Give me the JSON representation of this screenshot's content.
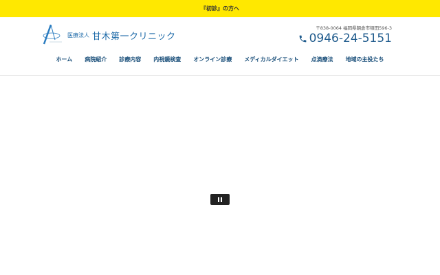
{
  "topbar": {
    "link": "『初診』の方へ"
  },
  "logo": {
    "sub": "医療法人",
    "name": "甘木第一クリニック"
  },
  "contact": {
    "address": "〒838-0064 福岡県朝倉市頓田596-3",
    "phone": "0946-24-5151"
  },
  "nav": [
    "ホーム",
    "病院紹介",
    "診療内容",
    "内視鏡検査",
    "オンライン診療",
    "メディカルダイエット",
    "点滴療法",
    "地域の主役たち"
  ],
  "colors": {
    "topbar": "#ffe800",
    "nav": "#1a4f7a",
    "brand": "#1d6aa8"
  }
}
